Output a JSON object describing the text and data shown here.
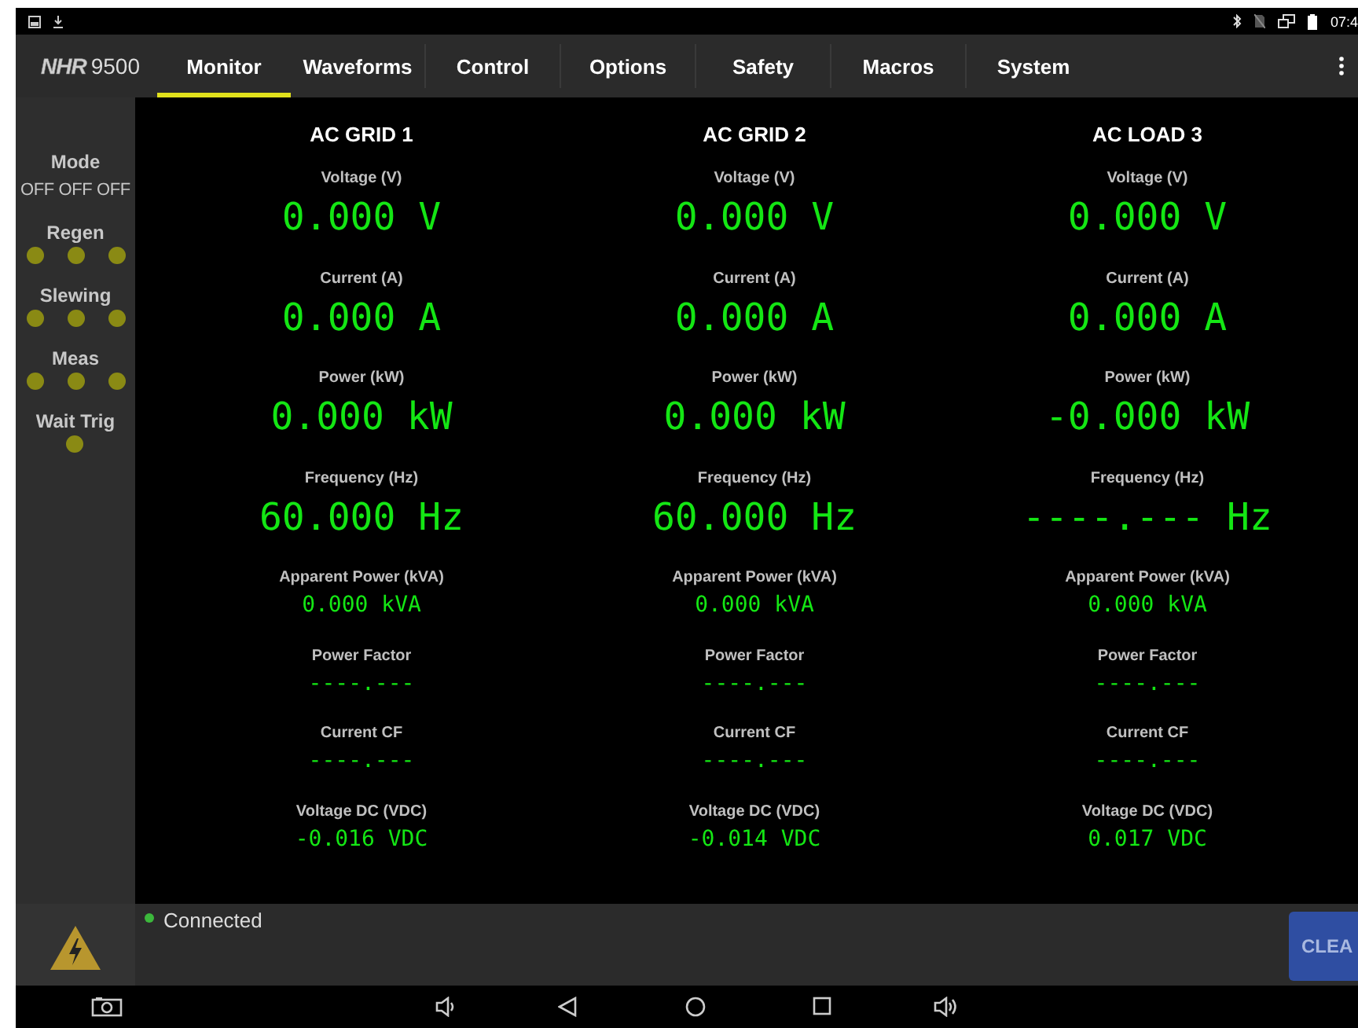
{
  "status_bar": {
    "time": "07:4"
  },
  "app_bar": {
    "logo_brand": "NHR",
    "logo_model": "9500",
    "tabs": [
      {
        "label": "Monitor",
        "selected": true
      },
      {
        "label": "Waveforms",
        "selected": false
      },
      {
        "label": "Control",
        "selected": false
      },
      {
        "label": "Options",
        "selected": false
      },
      {
        "label": "Safety",
        "selected": false
      },
      {
        "label": "Macros",
        "selected": false
      },
      {
        "label": "System",
        "selected": false
      }
    ]
  },
  "sidebar": {
    "mode_label": "Mode",
    "mode_value": "OFF OFF OFF",
    "indicators": [
      {
        "label": "Regen",
        "lights": [
          {
            "on": false
          },
          {
            "on": false
          },
          {
            "on": false
          }
        ]
      },
      {
        "label": "Slewing",
        "lights": [
          {
            "on": false
          },
          {
            "on": false
          },
          {
            "on": false
          }
        ]
      },
      {
        "label": "Meas",
        "lights": [
          {
            "on": false
          },
          {
            "on": false
          },
          {
            "on": false
          }
        ]
      },
      {
        "label": "Wait Trig",
        "lights": [
          {
            "on": false
          }
        ]
      }
    ]
  },
  "channels": [
    {
      "title": "AC GRID 1",
      "readings": [
        {
          "kind": "large",
          "label": "Voltage (V)",
          "value": "0.000 V"
        },
        {
          "kind": "large",
          "label": "Current (A)",
          "value": "0.000 A"
        },
        {
          "kind": "large",
          "label": "Power (kW)",
          "value": "0.000 kW"
        },
        {
          "kind": "large",
          "label": "Frequency (Hz)",
          "value": "60.000 Hz"
        },
        {
          "kind": "small",
          "label": "Apparent Power (kVA)",
          "value": "0.000 kVA"
        },
        {
          "kind": "small",
          "label": "Power Factor",
          "value": "----.---"
        },
        {
          "kind": "small",
          "label": "Current CF",
          "value": "----.---"
        },
        {
          "kind": "small",
          "label": "Voltage DC (VDC)",
          "value": "-0.016 VDC"
        }
      ]
    },
    {
      "title": "AC GRID 2",
      "readings": [
        {
          "kind": "large",
          "label": "Voltage (V)",
          "value": "0.000 V"
        },
        {
          "kind": "large",
          "label": "Current (A)",
          "value": "0.000 A"
        },
        {
          "kind": "large",
          "label": "Power (kW)",
          "value": "0.000 kW"
        },
        {
          "kind": "large",
          "label": "Frequency (Hz)",
          "value": "60.000 Hz"
        },
        {
          "kind": "small",
          "label": "Apparent Power (kVA)",
          "value": "0.000 kVA"
        },
        {
          "kind": "small",
          "label": "Power Factor",
          "value": "----.---"
        },
        {
          "kind": "small",
          "label": "Current CF",
          "value": "----.---"
        },
        {
          "kind": "small",
          "label": "Voltage DC (VDC)",
          "value": "-0.014 VDC"
        }
      ]
    },
    {
      "title": "AC LOAD 3",
      "readings": [
        {
          "kind": "large",
          "label": "Voltage (V)",
          "value": "0.000 V"
        },
        {
          "kind": "large",
          "label": "Current (A)",
          "value": "0.000 A"
        },
        {
          "kind": "large",
          "label": "Power (kW)",
          "value": "-0.000 kW"
        },
        {
          "kind": "large",
          "label": "Frequency (Hz)",
          "value": "----.--- Hz"
        },
        {
          "kind": "small",
          "label": "Apparent Power (kVA)",
          "value": "0.000 kVA"
        },
        {
          "kind": "small",
          "label": "Power Factor",
          "value": "----.---"
        },
        {
          "kind": "small",
          "label": "Current CF",
          "value": "----.---"
        },
        {
          "kind": "small",
          "label": "Voltage DC (VDC)",
          "value": "0.017 VDC"
        }
      ]
    }
  ],
  "footer": {
    "connection": "Connected",
    "connected": true,
    "clear_button": "CLEA"
  }
}
